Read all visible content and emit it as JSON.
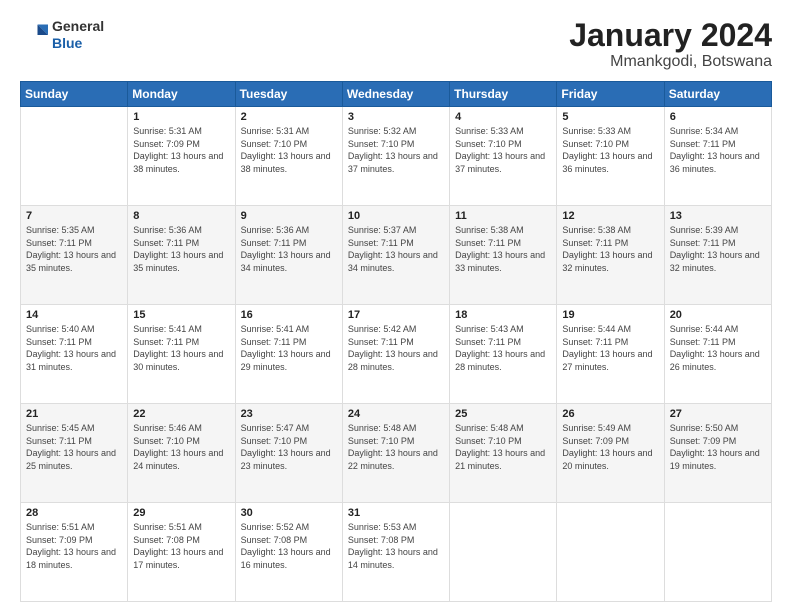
{
  "header": {
    "logo_line1": "General",
    "logo_line2": "Blue",
    "title": "January 2024",
    "location": "Mmankgodi, Botswana"
  },
  "weekdays": [
    "Sunday",
    "Monday",
    "Tuesday",
    "Wednesday",
    "Thursday",
    "Friday",
    "Saturday"
  ],
  "weeks": [
    [
      {
        "day": "",
        "sunrise": "",
        "sunset": "",
        "daylight": ""
      },
      {
        "day": "1",
        "sunrise": "5:31 AM",
        "sunset": "7:09 PM",
        "daylight": "13 hours and 38 minutes."
      },
      {
        "day": "2",
        "sunrise": "5:31 AM",
        "sunset": "7:10 PM",
        "daylight": "13 hours and 38 minutes."
      },
      {
        "day": "3",
        "sunrise": "5:32 AM",
        "sunset": "7:10 PM",
        "daylight": "13 hours and 37 minutes."
      },
      {
        "day": "4",
        "sunrise": "5:33 AM",
        "sunset": "7:10 PM",
        "daylight": "13 hours and 37 minutes."
      },
      {
        "day": "5",
        "sunrise": "5:33 AM",
        "sunset": "7:10 PM",
        "daylight": "13 hours and 36 minutes."
      },
      {
        "day": "6",
        "sunrise": "5:34 AM",
        "sunset": "7:11 PM",
        "daylight": "13 hours and 36 minutes."
      }
    ],
    [
      {
        "day": "7",
        "sunrise": "5:35 AM",
        "sunset": "7:11 PM",
        "daylight": "13 hours and 35 minutes."
      },
      {
        "day": "8",
        "sunrise": "5:36 AM",
        "sunset": "7:11 PM",
        "daylight": "13 hours and 35 minutes."
      },
      {
        "day": "9",
        "sunrise": "5:36 AM",
        "sunset": "7:11 PM",
        "daylight": "13 hours and 34 minutes."
      },
      {
        "day": "10",
        "sunrise": "5:37 AM",
        "sunset": "7:11 PM",
        "daylight": "13 hours and 34 minutes."
      },
      {
        "day": "11",
        "sunrise": "5:38 AM",
        "sunset": "7:11 PM",
        "daylight": "13 hours and 33 minutes."
      },
      {
        "day": "12",
        "sunrise": "5:38 AM",
        "sunset": "7:11 PM",
        "daylight": "13 hours and 32 minutes."
      },
      {
        "day": "13",
        "sunrise": "5:39 AM",
        "sunset": "7:11 PM",
        "daylight": "13 hours and 32 minutes."
      }
    ],
    [
      {
        "day": "14",
        "sunrise": "5:40 AM",
        "sunset": "7:11 PM",
        "daylight": "13 hours and 31 minutes."
      },
      {
        "day": "15",
        "sunrise": "5:41 AM",
        "sunset": "7:11 PM",
        "daylight": "13 hours and 30 minutes."
      },
      {
        "day": "16",
        "sunrise": "5:41 AM",
        "sunset": "7:11 PM",
        "daylight": "13 hours and 29 minutes."
      },
      {
        "day": "17",
        "sunrise": "5:42 AM",
        "sunset": "7:11 PM",
        "daylight": "13 hours and 28 minutes."
      },
      {
        "day": "18",
        "sunrise": "5:43 AM",
        "sunset": "7:11 PM",
        "daylight": "13 hours and 28 minutes."
      },
      {
        "day": "19",
        "sunrise": "5:44 AM",
        "sunset": "7:11 PM",
        "daylight": "13 hours and 27 minutes."
      },
      {
        "day": "20",
        "sunrise": "5:44 AM",
        "sunset": "7:11 PM",
        "daylight": "13 hours and 26 minutes."
      }
    ],
    [
      {
        "day": "21",
        "sunrise": "5:45 AM",
        "sunset": "7:11 PM",
        "daylight": "13 hours and 25 minutes."
      },
      {
        "day": "22",
        "sunrise": "5:46 AM",
        "sunset": "7:10 PM",
        "daylight": "13 hours and 24 minutes."
      },
      {
        "day": "23",
        "sunrise": "5:47 AM",
        "sunset": "7:10 PM",
        "daylight": "13 hours and 23 minutes."
      },
      {
        "day": "24",
        "sunrise": "5:48 AM",
        "sunset": "7:10 PM",
        "daylight": "13 hours and 22 minutes."
      },
      {
        "day": "25",
        "sunrise": "5:48 AM",
        "sunset": "7:10 PM",
        "daylight": "13 hours and 21 minutes."
      },
      {
        "day": "26",
        "sunrise": "5:49 AM",
        "sunset": "7:09 PM",
        "daylight": "13 hours and 20 minutes."
      },
      {
        "day": "27",
        "sunrise": "5:50 AM",
        "sunset": "7:09 PM",
        "daylight": "13 hours and 19 minutes."
      }
    ],
    [
      {
        "day": "28",
        "sunrise": "5:51 AM",
        "sunset": "7:09 PM",
        "daylight": "13 hours and 18 minutes."
      },
      {
        "day": "29",
        "sunrise": "5:51 AM",
        "sunset": "7:08 PM",
        "daylight": "13 hours and 17 minutes."
      },
      {
        "day": "30",
        "sunrise": "5:52 AM",
        "sunset": "7:08 PM",
        "daylight": "13 hours and 16 minutes."
      },
      {
        "day": "31",
        "sunrise": "5:53 AM",
        "sunset": "7:08 PM",
        "daylight": "13 hours and 14 minutes."
      },
      {
        "day": "",
        "sunrise": "",
        "sunset": "",
        "daylight": ""
      },
      {
        "day": "",
        "sunrise": "",
        "sunset": "",
        "daylight": ""
      },
      {
        "day": "",
        "sunrise": "",
        "sunset": "",
        "daylight": ""
      }
    ]
  ],
  "labels": {
    "sunrise_prefix": "Sunrise: ",
    "sunset_prefix": "Sunset: ",
    "daylight_prefix": "Daylight: "
  }
}
